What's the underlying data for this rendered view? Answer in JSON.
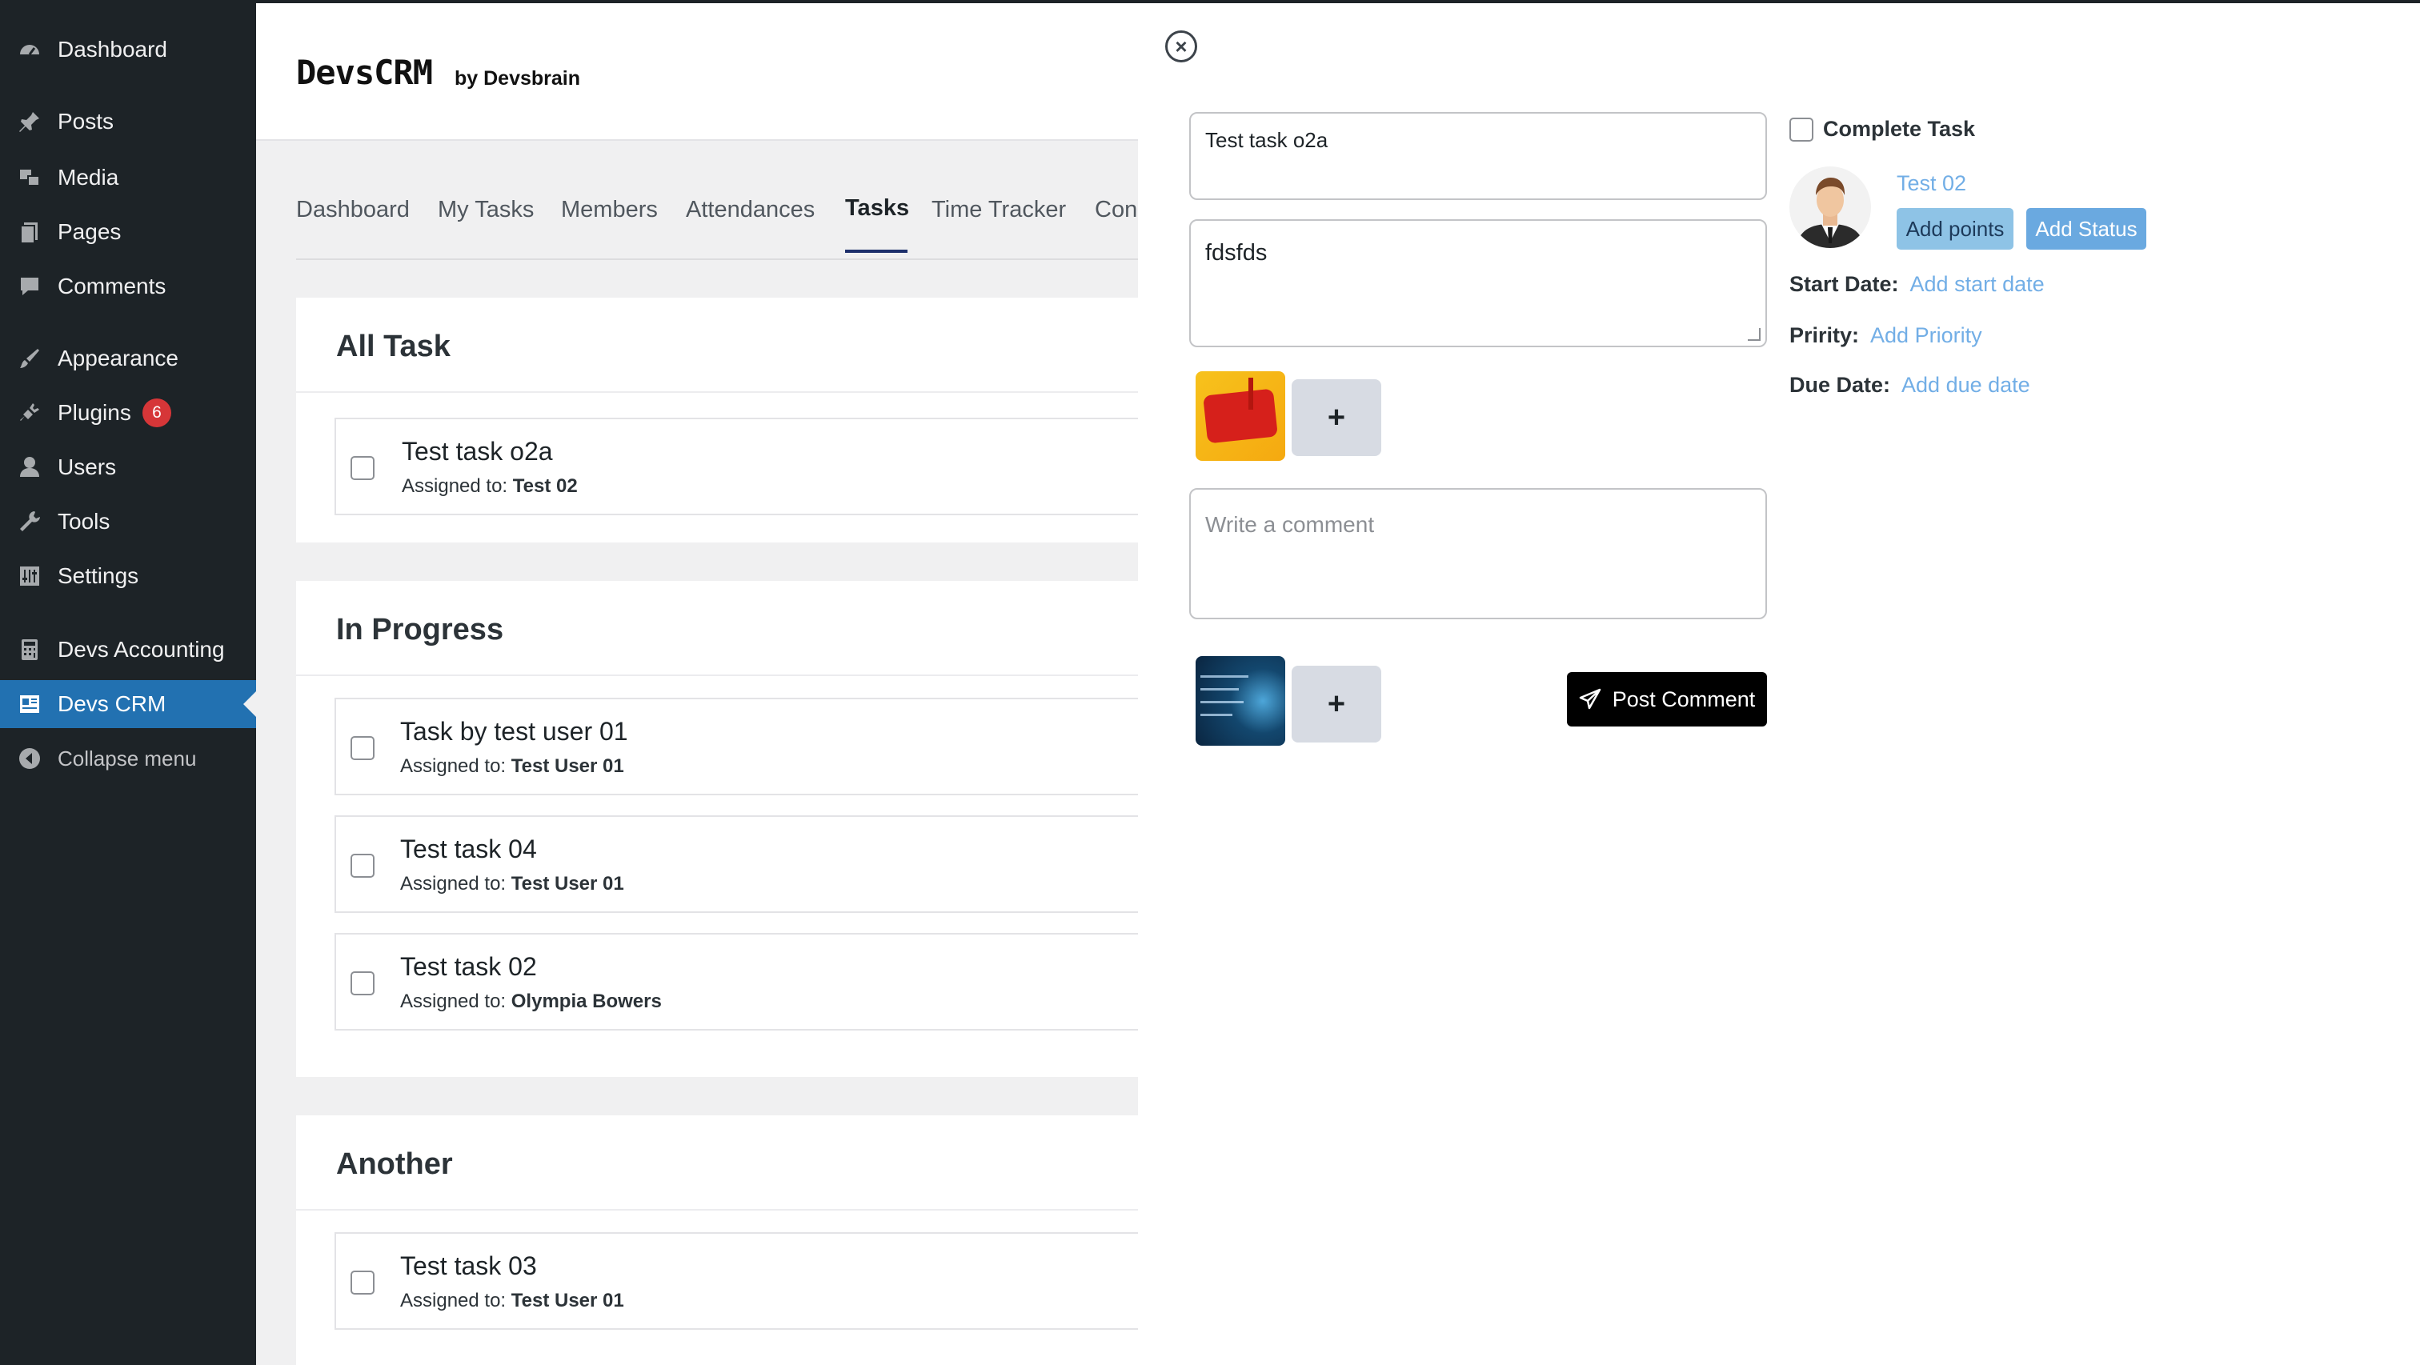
{
  "sidebar": {
    "items": [
      {
        "label": "Dashboard",
        "icon": "dashboard-icon"
      },
      {
        "label": "Posts",
        "icon": "pin-icon"
      },
      {
        "label": "Media",
        "icon": "media-icon"
      },
      {
        "label": "Pages",
        "icon": "pages-icon"
      },
      {
        "label": "Comments",
        "icon": "comments-icon"
      },
      {
        "label": "Appearance",
        "icon": "brush-icon"
      },
      {
        "label": "Plugins",
        "icon": "plugin-icon",
        "badge": "6"
      },
      {
        "label": "Users",
        "icon": "users-icon"
      },
      {
        "label": "Tools",
        "icon": "wrench-icon"
      },
      {
        "label": "Settings",
        "icon": "settings-icon"
      },
      {
        "label": "Devs Accounting",
        "icon": "calculator-icon"
      },
      {
        "label": "Devs CRM",
        "icon": "crm-icon",
        "active": true
      },
      {
        "label": "Collapse menu",
        "icon": "collapse-icon"
      }
    ]
  },
  "header": {
    "brand": "DevsCRM",
    "brand_sub": "by Devsbrain"
  },
  "tabs": [
    "Dashboard",
    "My Tasks",
    "Members",
    "Attendances",
    "Tasks",
    "Time Tracker",
    "Con"
  ],
  "active_tab": "Tasks",
  "sections": [
    {
      "title": "All Task",
      "tasks": [
        {
          "title": "Test task o2a",
          "assigned_label": "Assigned to:",
          "assignee": "Test 02"
        }
      ]
    },
    {
      "title": "In Progress",
      "tasks": [
        {
          "title": "Task by test user 01",
          "assigned_label": "Assigned to:",
          "assignee": "Test User 01"
        },
        {
          "title": "Test task 04",
          "assigned_label": "Assigned to:",
          "assignee": "Test User 01"
        },
        {
          "title": "Test task 02",
          "assigned_label": "Assigned to:",
          "assignee": "Olympia Bowers"
        }
      ]
    },
    {
      "title": "Another",
      "tasks": [
        {
          "title": "Test task 03",
          "assigned_label": "Assigned to:",
          "assignee": "Test User 01"
        }
      ]
    }
  ],
  "panel": {
    "title_value": "Test task o2a",
    "description_value": "fdsfds",
    "comment_placeholder": "Write a comment",
    "add_image_label": "+",
    "post_comment_label": "Post Comment",
    "complete_task_label": "Complete Task",
    "assignee": "Test 02",
    "add_points_label": "Add points",
    "add_status_label": "Add Status",
    "start_date_label": "Start Date:",
    "start_date_value": "Add start date",
    "priority_label": "Pririty:",
    "priority_value": "Add Priority",
    "due_date_label": "Due Date:",
    "due_date_value": "Add due date"
  },
  "colors": {
    "sidebar_bg": "#1d2327",
    "active_menu": "#2271b1",
    "link": "#72aee6",
    "badge": "#d63638"
  }
}
